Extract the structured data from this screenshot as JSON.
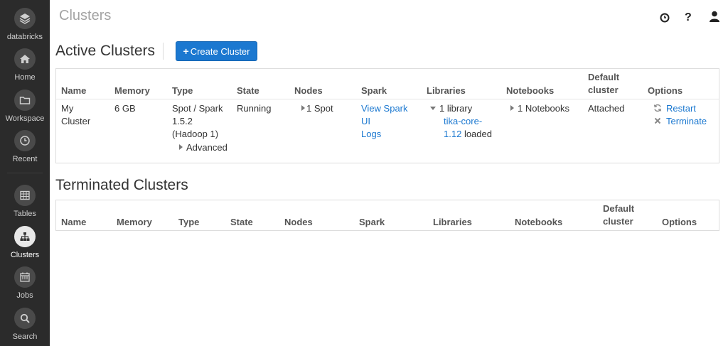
{
  "sidebar": {
    "items": [
      {
        "label": "databricks",
        "icon": "databricks-logo-icon"
      },
      {
        "label": "Home",
        "icon": "home-icon"
      },
      {
        "label": "Workspace",
        "icon": "folder-icon"
      },
      {
        "label": "Recent",
        "icon": "clock-icon"
      },
      {
        "label": "Tables",
        "icon": "table-icon"
      },
      {
        "label": "Clusters",
        "icon": "clusters-icon",
        "active": true
      },
      {
        "label": "Jobs",
        "icon": "calendar-icon"
      },
      {
        "label": "Search",
        "icon": "search-icon"
      }
    ]
  },
  "header": {
    "title": "Clusters",
    "icons": [
      "clock-icon",
      "help-icon",
      "user-icon"
    ]
  },
  "active": {
    "title": "Active Clusters",
    "create_label": "Create Cluster",
    "columns": {
      "name": "Name",
      "memory": "Memory",
      "type": "Type",
      "state": "State",
      "nodes": "Nodes",
      "spark": "Spark",
      "libraries": "Libraries",
      "notebooks": "Notebooks",
      "default_cluster_1": "Default",
      "default_cluster_2": "cluster",
      "options": "Options"
    },
    "row": {
      "name_1": "My",
      "name_2": "Cluster",
      "memory": "6 GB",
      "type_1": "Spot / Spark",
      "type_2": "1.5.2",
      "type_3": "(Hadoop 1)",
      "type_advanced": "Advanced",
      "state": "Running",
      "nodes": "1 Spot",
      "spark_1": "View Spark",
      "spark_2": "UI",
      "spark_3": "Logs",
      "libraries_1": "1 library",
      "libraries_2": "tika-core-",
      "libraries_3": "1.12",
      "libraries_3b": "loaded",
      "notebooks": "1 Notebooks",
      "default_cluster": "Attached",
      "restart": "Restart",
      "terminate": "Terminate"
    }
  },
  "terminated": {
    "title": "Terminated Clusters",
    "columns": {
      "name": "Name",
      "memory": "Memory",
      "type": "Type",
      "state": "State",
      "nodes": "Nodes",
      "spark": "Spark",
      "libraries": "Libraries",
      "notebooks": "Notebooks",
      "default_cluster_1": "Default",
      "default_cluster_2": "cluster",
      "options": "Options"
    }
  },
  "colors": {
    "sidebar_bg": "#2b2b2b",
    "accent": "#1b78d0",
    "title_gray": "#a3a3a3"
  }
}
